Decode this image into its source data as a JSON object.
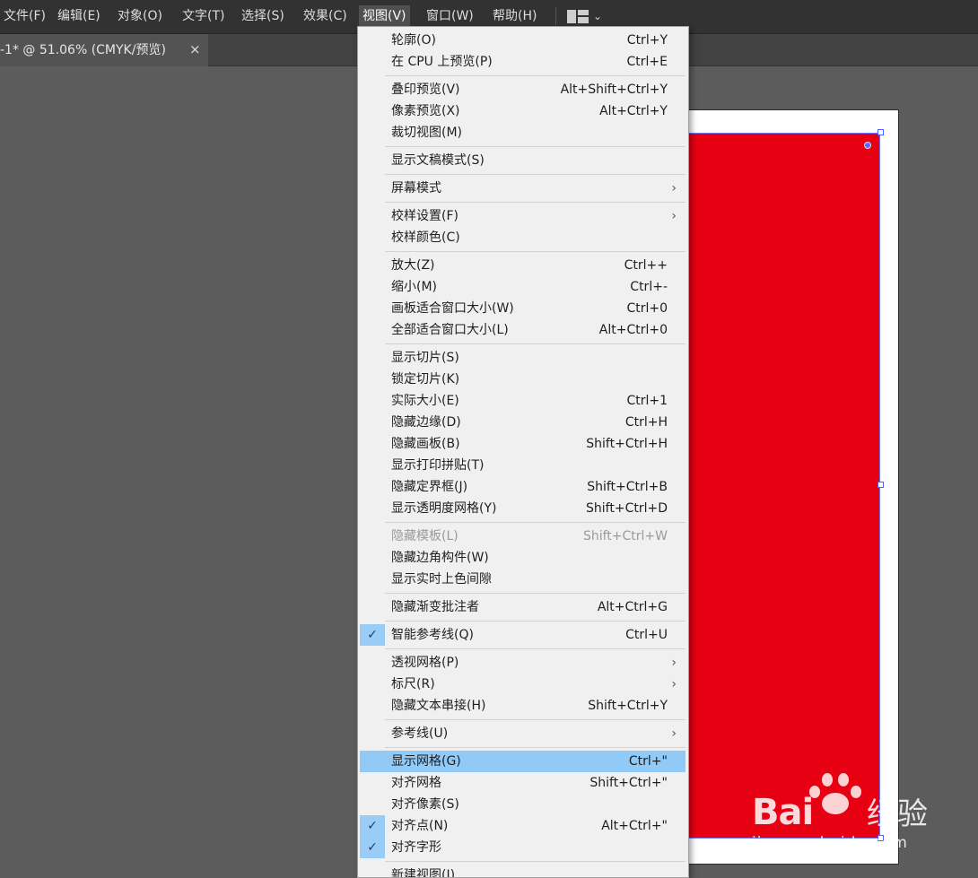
{
  "menubar": {
    "items": [
      {
        "id": "file",
        "label": "文件(F)"
      },
      {
        "id": "edit",
        "label": "编辑(E)"
      },
      {
        "id": "object",
        "label": "对象(O)"
      },
      {
        "id": "type",
        "label": "文字(T)"
      },
      {
        "id": "select",
        "label": "选择(S)"
      },
      {
        "id": "effect",
        "label": "效果(C)"
      },
      {
        "id": "view",
        "label": "视图(V)",
        "active": true
      },
      {
        "id": "window",
        "label": "窗口(W)"
      },
      {
        "id": "help",
        "label": "帮助(H)"
      }
    ],
    "workspace_icon": "workspace-layout-icon",
    "workspace_chevron": "⌄"
  },
  "document_tab": {
    "title": "-1* @ 51.06% (CMYK/预览)",
    "close": "×"
  },
  "view_menu": {
    "items": [
      {
        "label": "轮廓(O)",
        "shortcut": "Ctrl+Y"
      },
      {
        "label": "在 CPU 上预览(P)",
        "shortcut": "Ctrl+E"
      },
      {
        "separator": true
      },
      {
        "label": "叠印预览(V)",
        "shortcut": "Alt+Shift+Ctrl+Y"
      },
      {
        "label": "像素预览(X)",
        "shortcut": "Alt+Ctrl+Y"
      },
      {
        "label": "裁切视图(M)",
        "shortcut": ""
      },
      {
        "separator": true
      },
      {
        "label": "显示文稿模式(S)",
        "shortcut": ""
      },
      {
        "separator": true
      },
      {
        "label": "屏幕模式",
        "shortcut": "",
        "submenu": true
      },
      {
        "separator": true
      },
      {
        "label": "校样设置(F)",
        "shortcut": "",
        "submenu": true
      },
      {
        "label": "校样颜色(C)",
        "shortcut": ""
      },
      {
        "separator": true
      },
      {
        "label": "放大(Z)",
        "shortcut": "Ctrl++"
      },
      {
        "label": "缩小(M)",
        "shortcut": "Ctrl+-"
      },
      {
        "label": "画板适合窗口大小(W)",
        "shortcut": "Ctrl+0"
      },
      {
        "label": "全部适合窗口大小(L)",
        "shortcut": "Alt+Ctrl+0"
      },
      {
        "separator": true
      },
      {
        "label": "显示切片(S)",
        "shortcut": ""
      },
      {
        "label": "锁定切片(K)",
        "shortcut": ""
      },
      {
        "label": "实际大小(E)",
        "shortcut": "Ctrl+1"
      },
      {
        "label": "隐藏边缘(D)",
        "shortcut": "Ctrl+H"
      },
      {
        "label": "隐藏画板(B)",
        "shortcut": "Shift+Ctrl+H"
      },
      {
        "label": "显示打印拼贴(T)",
        "shortcut": ""
      },
      {
        "label": "隐藏定界框(J)",
        "shortcut": "Shift+Ctrl+B"
      },
      {
        "label": "显示透明度网格(Y)",
        "shortcut": "Shift+Ctrl+D"
      },
      {
        "separator": true
      },
      {
        "label": "隐藏模板(L)",
        "shortcut": "Shift+Ctrl+W",
        "disabled": true
      },
      {
        "label": "隐藏边角构件(W)",
        "shortcut": ""
      },
      {
        "label": "显示实时上色间隙",
        "shortcut": ""
      },
      {
        "separator": true
      },
      {
        "label": "隐藏渐变批注者",
        "shortcut": "Alt+Ctrl+G"
      },
      {
        "separator": true
      },
      {
        "label": "智能参考线(Q)",
        "shortcut": "Ctrl+U",
        "checked": true
      },
      {
        "separator": true
      },
      {
        "label": "透视网格(P)",
        "shortcut": "",
        "submenu": true
      },
      {
        "label": "标尺(R)",
        "shortcut": "",
        "submenu": true
      },
      {
        "label": "隐藏文本串接(H)",
        "shortcut": "Shift+Ctrl+Y"
      },
      {
        "separator": true
      },
      {
        "label": "参考线(U)",
        "shortcut": "",
        "submenu": true
      },
      {
        "separator": true
      },
      {
        "label": "显示网格(G)",
        "shortcut": "Ctrl+\"",
        "highlighted": true
      },
      {
        "label": "对齐网格",
        "shortcut": "Shift+Ctrl+\""
      },
      {
        "label": "对齐像素(S)",
        "shortcut": ""
      },
      {
        "label": "对齐点(N)",
        "shortcut": "Alt+Ctrl+\"",
        "checked": true
      },
      {
        "label": "对齐字形",
        "shortcut": "",
        "checked": true
      },
      {
        "separator": true
      },
      {
        "label": "新建视图(I)...",
        "shortcut": ""
      }
    ],
    "check_glyph": "✓",
    "submenu_glyph": "›"
  },
  "watermark": {
    "brand": "Bai",
    "brand_du": "du",
    "brand_cn": "经验",
    "url": "jingyan.baidu.com"
  },
  "colors": {
    "menubar_bg": "#323232",
    "canvas_bg": "#5c5c5c",
    "artwork_red": "#e60012",
    "selection_blue": "#4f5fff",
    "menu_highlight": "#91c9f7"
  }
}
